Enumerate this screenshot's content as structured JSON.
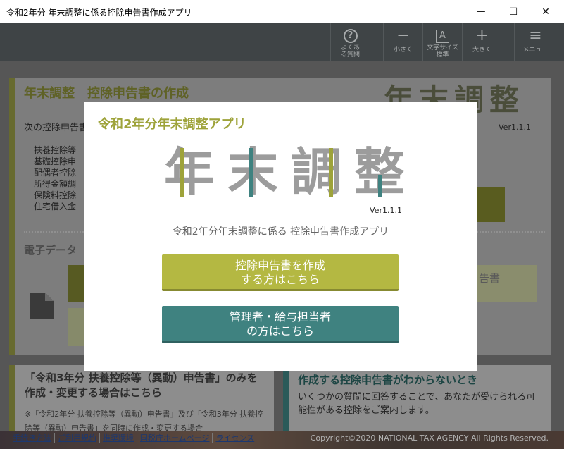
{
  "window": {
    "title": "令和2年分 年末調整に係る控除申告書作成アプリ",
    "minimize": "—",
    "maximize": "☐",
    "close": "✕"
  },
  "toolbar": {
    "faq": {
      "label": "よくある質問",
      "icon": "?"
    },
    "smaller": {
      "label": "小さく",
      "icon": "−"
    },
    "font_size": {
      "label": "文字サイズ 標準",
      "icon": "A"
    },
    "larger": {
      "label": "大きく",
      "icon": "+"
    },
    "menu": {
      "label": "メニュー",
      "icon": "≡"
    }
  },
  "main": {
    "title": "年末調整　控除申告書の作成",
    "logo": [
      "年",
      "末",
      "調",
      "整"
    ],
    "version": "Ver1.1.1",
    "intro": "次の控除申告書",
    "items": [
      "扶養控除等",
      "基礎控除申",
      "配偶者控除",
      "所得金額調",
      "保険料控除",
      "住宅借入金"
    ],
    "section2_title": "電子データ",
    "section2_btn": "告書"
  },
  "cards": {
    "left_title": "「令和3年分 扶養控除等（異動）申告書」のみを作成・変更する場合はこちら",
    "left_note": "※「令和2年分 扶養控除等（異動）申告書」及び「令和3年分 扶養控除等（異動）申告書」を同時に作成・変更する場合",
    "right_title": "作成する控除申告書がわからないとき",
    "right_body": "いくつかの質問に回答することで、あなたが受けられる可能性がある控除をご案内します。"
  },
  "footer": {
    "links": [
      "手続き方法",
      "ご利用規約",
      "推奨環境",
      "国税庁ホームページ",
      "ライセンス"
    ],
    "copyright": "Copyright©2020 NATIONAL TAX AGENCY All Rights Reserved."
  },
  "modal": {
    "title": "令和2年分年末調整アプリ",
    "logo": [
      "年",
      "末",
      "調",
      "整"
    ],
    "version": "Ver1.1.1",
    "subtitle": "令和2年分年末調整に係る 控除申告書作成アプリ",
    "btn_create": [
      "控除申告書を作成",
      "する方はこちら"
    ],
    "btn_admin": [
      "管理者・給与担当者",
      "の方はこちら"
    ]
  },
  "colors": {
    "olive": "#9ea33a",
    "btn_olive": "#b4b842",
    "teal": "#3f8280",
    "gray": "#a5a5a5"
  }
}
